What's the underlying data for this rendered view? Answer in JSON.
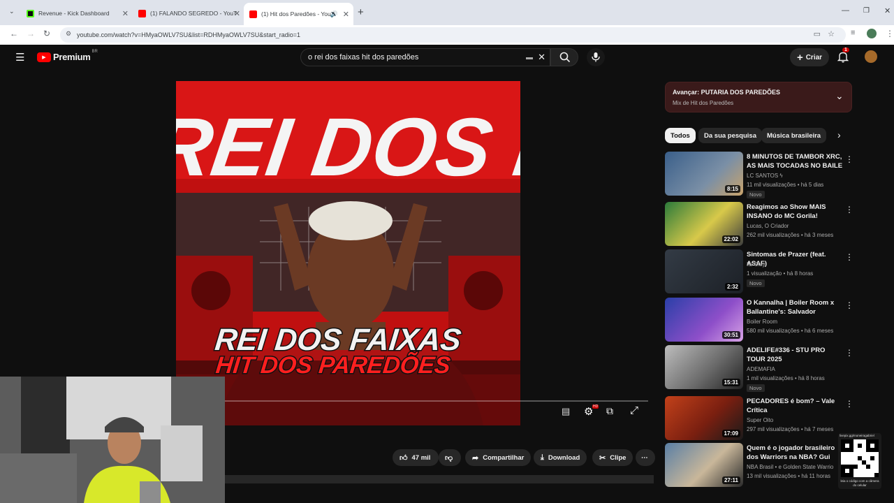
{
  "browser": {
    "tabs": [
      {
        "title": "Revenue - Kick Dashboard",
        "color": "#53fc18"
      },
      {
        "title": "(1) FALANDO SEGREDO - YouT",
        "color": "#ff0000"
      },
      {
        "title": "(1) Hit dos Paredões - YouT",
        "color": "#ff0000"
      }
    ],
    "url": "youtube.com/watch?v=HMyaOWLV7SU&list=RDHMyaOWLV7SU&start_radio=1"
  },
  "youtube": {
    "logo_text": "Premium",
    "region": "BR",
    "search_value": "o rei dos faixas hit dos paredões",
    "create_label": "Criar",
    "notification_count": "1"
  },
  "video": {
    "cover_line1": "REI DOS FAIXAS",
    "cover_line2": "HIT DOS PAREDÕES",
    "cover_top_text": "REI DOS F"
  },
  "actions": {
    "likes": "47 mil",
    "share": "Compartilhar",
    "download": "Download",
    "clip": "Clipe"
  },
  "sidebar": {
    "next_label": "Avançar: PUTARIA DOS PAREDÕES",
    "mix_label": "Mix de Hit dos Paredões",
    "chips": [
      "Todos",
      "Da sua pesquisa",
      "Música brasileira"
    ],
    "items": [
      {
        "title": "8 MINUTOS DE TAMBOR XRC, AS MAIS TOCADAS NO BAILE ...",
        "channel": "LC SANTOS ϟ",
        "meta": "11 mil visualizações • há 5 dias",
        "badge": "Novo",
        "duration": "8:15",
        "thumb": "#3a5f8a"
      },
      {
        "title": "Reagimos ao Show MAIS INSANO do MC Gorila!",
        "channel": "Lucas, O Criador",
        "meta": "262 mil visualizações • há 3 meses",
        "badge": "",
        "duration": "22:02",
        "thumb": "#2b7a3a"
      },
      {
        "title": "Sintomas de Prazer (feat. ASAF)",
        "channel": "Its Clay",
        "meta": "1 visualização • há 8 horas",
        "badge": "Novo",
        "duration": "2:32",
        "thumb": "#333b45"
      },
      {
        "title": "O Kannalha | Boiler Room x Ballantine's: Salvador",
        "channel": "Boiler Room",
        "meta": "580 mil visualizações • há 6 meses",
        "badge": "",
        "duration": "30:51",
        "thumb": "#2a3fa8"
      },
      {
        "title": "ADELIFE#336 - STU PRO TOUR 2025",
        "channel": "ADEMAFIA",
        "meta": "1 mil visualizações • há 8 horas",
        "badge": "Novo",
        "duration": "15:31",
        "thumb": "#8d8d8d"
      },
      {
        "title": "PECADORES é bom? – Vale Crítica",
        "channel": "Super Oito",
        "meta": "297 mil visualizações • há 7 meses",
        "badge": "",
        "duration": "17:09",
        "thumb": "#c2411a"
      },
      {
        "title": "Quem é o jogador brasileiro dos Warriors na NBA? Gui Santos ...",
        "channel": "NBA Brasil • e Golden State Warrio",
        "meta": "13 mil visualizações • há 11 horas",
        "badge": "",
        "duration": "27:11",
        "thumb": "#5a7fa5"
      }
    ]
  },
  "overlay": {
    "qr_url": "livepix.gg/moneiragabriel",
    "qr_caption": "leia o código com a câmera do celular"
  }
}
